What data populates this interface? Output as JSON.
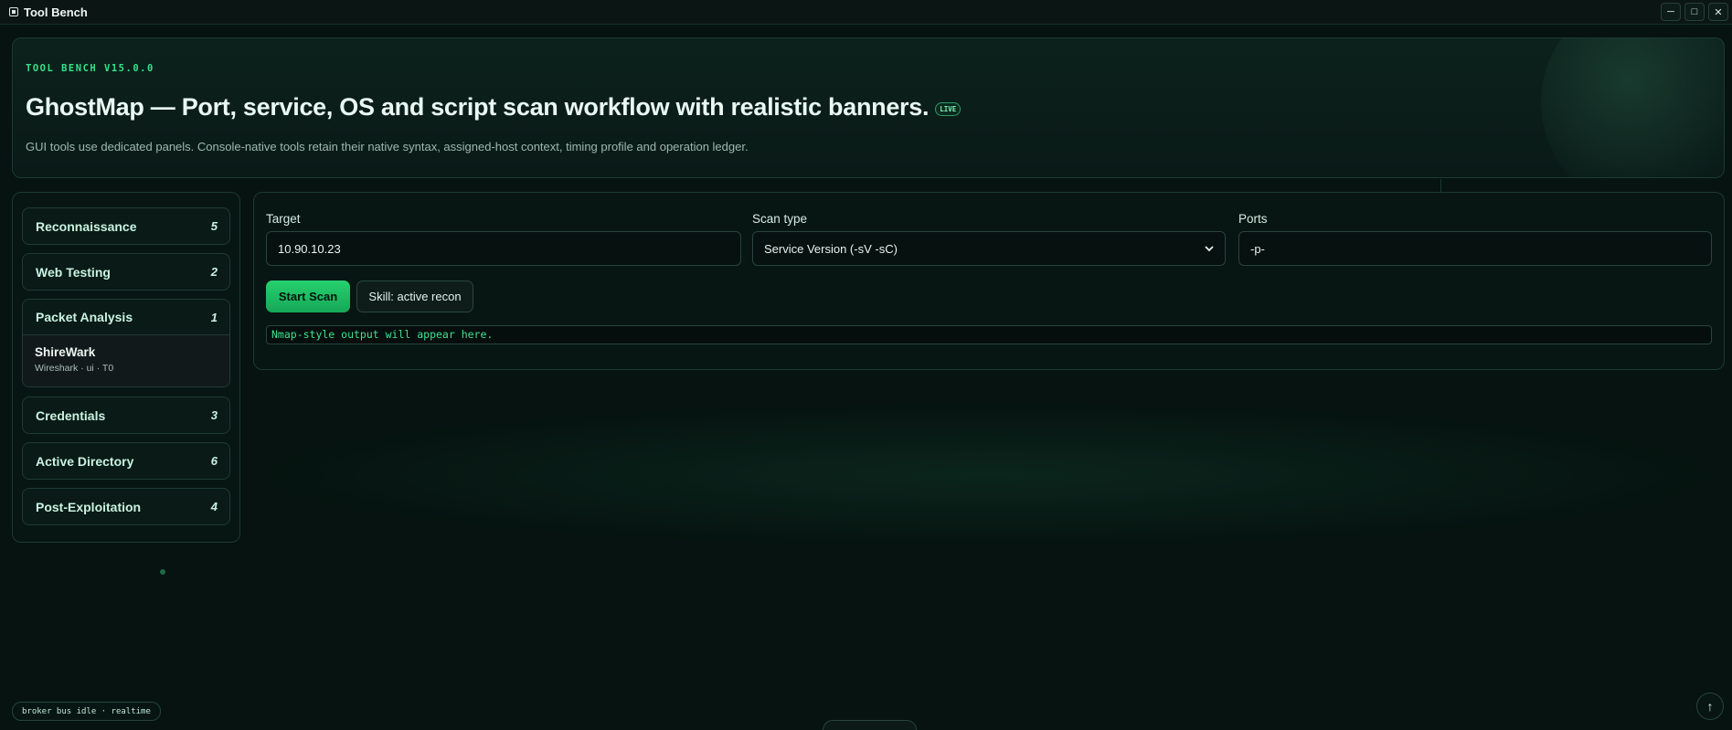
{
  "window": {
    "title": "Tool Bench",
    "controls": {
      "minimize": "─",
      "maximize": "□",
      "close": "✕"
    }
  },
  "hero": {
    "kicker": "TOOL BENCH V15.0.0",
    "title": "GhostMap — Port, service, OS and script scan workflow with realistic banners.",
    "badge": "LIVE",
    "description": "GUI tools use dedicated panels. Console-native tools retain their native syntax, assigned-host context, timing profile and operation ledger."
  },
  "sidebar": {
    "categories": [
      {
        "label": "Reconnaissance",
        "count": "5"
      },
      {
        "label": "Web Testing",
        "count": "2"
      },
      {
        "label": "Packet Analysis",
        "count": "1",
        "expanded": true,
        "tools": [
          {
            "name": "ShireWark",
            "meta": "Wireshark · ui · T0"
          }
        ]
      },
      {
        "label": "Credentials",
        "count": "3"
      },
      {
        "label": "Active Directory",
        "count": "6"
      },
      {
        "label": "Post-Exploitation",
        "count": "4"
      }
    ]
  },
  "scan": {
    "target_label": "Target",
    "target_value": "10.90.10.23",
    "scan_type_label": "Scan type",
    "scan_type_value": "Service Version (-sV -sC)",
    "ports_label": "Ports",
    "ports_value": "-p-",
    "start_button": "Start Scan",
    "skill_button": "Skill: active recon",
    "output_placeholder": "Nmap-style output will appear here."
  },
  "footer": {
    "status": "broker bus idle · realtime",
    "scroll_top": "↑"
  },
  "colors": {
    "accent": "#25d06e",
    "background": "#061310",
    "mono_green": "#3fe08f"
  }
}
